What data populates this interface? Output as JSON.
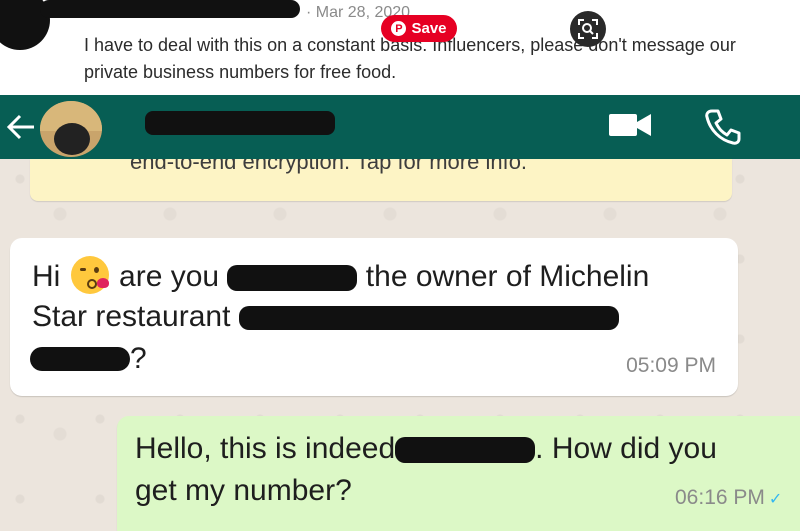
{
  "post": {
    "date": "· Mar 28, 2020",
    "text": "I have to deal with this on a constant basis. Influencers, please don't message our private business numbers for free food.",
    "save_label": "Save",
    "pin_glyph": "P"
  },
  "whatsapp": {
    "header": {
      "back_icon": "arrow-left-icon",
      "video_icon": "video-camera-icon",
      "call_icon": "phone-icon",
      "color": "#075e54"
    },
    "encryption_notice": "end-to-end encryption. Tap for more info.",
    "messages": [
      {
        "direction": "incoming",
        "text_a": "Hi",
        "text_b": "are you",
        "text_c": "the owner of Michelin",
        "text_d": "Star restaurant",
        "text_e": "?",
        "time": "05:09 PM"
      },
      {
        "direction": "outgoing",
        "text_a": "Hello, this is indeed",
        "text_b": ". How did you",
        "text_c": "get my number?",
        "time": "06:16 PM",
        "status_icon": "double-check-icon"
      }
    ],
    "colors": {
      "incoming_bubble": "#ffffff",
      "outgoing_bubble": "#dcf8c6",
      "chat_bg": "#ece5dd",
      "save_red": "#e60023"
    }
  }
}
